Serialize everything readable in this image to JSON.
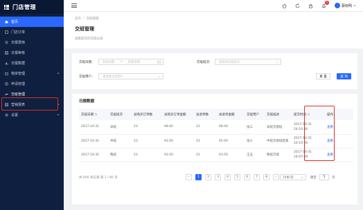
{
  "app": {
    "title": "门店管理",
    "brand_color": "#2a68ff",
    "sidebar_bg": "#0f1f3f"
  },
  "sidebar": {
    "items": [
      {
        "label": "首页",
        "icon": "home-icon"
      },
      {
        "label": "门店订单",
        "icon": "file-icon"
      },
      {
        "label": "日报费用",
        "icon": "list-icon"
      },
      {
        "label": "日报审核",
        "icon": "audit-icon"
      },
      {
        "label": "日报数据",
        "icon": "data-icon"
      },
      {
        "label": "物资管理",
        "icon": "box-icon",
        "expandable": true
      },
      {
        "label": "申请管理",
        "icon": "clock-icon"
      },
      {
        "label": "交班管理",
        "icon": "handover-icon"
      },
      {
        "label": "营销报表",
        "icon": "chart-icon",
        "expandable": true
      },
      {
        "label": "设置",
        "icon": "gear-icon",
        "expandable": true
      }
    ]
  },
  "topbar": {
    "username": "蔡晓明",
    "notification_count": "1"
  },
  "header": {
    "breadcrumb": [
      "首页",
      "/",
      "交班管理"
    ],
    "title": "交班管理",
    "description": "查看提交的交班记录"
  },
  "filter": {
    "date_label": "交班日期：",
    "date_start_placeholder": "开始日期",
    "date_sep": "→",
    "date_end_placeholder": "结束日期",
    "shift_label": "交班班次：",
    "shift_placeholder": "请选择交班班次",
    "user_label": "交班用户：",
    "user_placeholder": "请选择交班用户",
    "reset_label": "重 置",
    "query_label": "查 询"
  },
  "table": {
    "title": "日报数据",
    "columns": [
      "交班日期",
      "交班班次",
      "总购买订单数",
      "总购买订单金额",
      "总退单数",
      "总退单金额",
      "交班用户",
      "交班描述",
      "提交时间",
      "操作"
    ],
    "rows": [
      [
        "2017-10-31",
        "早班",
        "23",
        "¥8.00",
        "23",
        "¥8.00",
        "张三",
        "早班交接班",
        "2017-10-31 24:10:36",
        "查看"
      ],
      [
        "2017-10-31",
        "中班",
        "23",
        "¥2.00",
        "23",
        "¥2.00",
        "张三",
        "中班交接班结束",
        "2017-10-31 24:10:36",
        "查看"
      ],
      [
        "2017-10-31",
        "晚班",
        "23",
        "¥3.50",
        "23",
        "¥3.50",
        "王五",
        "晚班交接",
        "2017-10-31 24:07:09",
        "查看"
      ]
    ]
  },
  "pagination": {
    "total_text": "共 400 条记录 第 1 / 80 页",
    "prev": "‹",
    "pages": [
      "1",
      "2",
      "3",
      "4",
      "5",
      "6",
      "7",
      "8",
      "9"
    ],
    "next": "›",
    "current": "1",
    "page_size": "10条/页",
    "goto_label": "跳至",
    "goto_value": "5",
    "goto_suffix": "页"
  }
}
